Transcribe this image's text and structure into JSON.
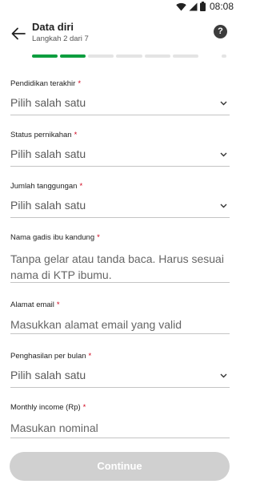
{
  "status_bar": {
    "time": "08:08",
    "icons": [
      "wifi-icon",
      "signal-icon",
      "battery-icon"
    ]
  },
  "header": {
    "title": "Data diri",
    "subtitle": "Langkah 2 dari 7",
    "back_icon": "arrow-left-icon",
    "help_label": "?"
  },
  "progress": {
    "current_step": 2,
    "total_steps": 7,
    "colors": {
      "done": "#0d9e3f",
      "pending": "#e4e4e4"
    }
  },
  "form": {
    "required_mark": "*",
    "fields": [
      {
        "label": "Pendidikan terakhir",
        "type": "select",
        "value": "Pilih salah satu"
      },
      {
        "label": "Status pernikahan",
        "type": "select",
        "value": "Pilih salah satu"
      },
      {
        "label": "Jumlah tanggungan",
        "type": "select",
        "value": "Pilih salah satu"
      },
      {
        "label": "Nama gadis ibu kandung",
        "type": "text",
        "placeholder": "Tanpa gelar atau tanda baca. Harus sesuai nama di KTP ibumu."
      },
      {
        "label": "Alamat email",
        "type": "text",
        "placeholder": "Masukkan alamat email yang valid"
      },
      {
        "label": "Penghasilan per bulan",
        "type": "select",
        "value": "Pilih salah satu"
      },
      {
        "label": "Monthly income (Rp)",
        "type": "text",
        "placeholder": "Masukan nominal"
      }
    ]
  },
  "continue_button": {
    "label": "Continue",
    "state": "disabled",
    "color": "#d0d0d0"
  }
}
